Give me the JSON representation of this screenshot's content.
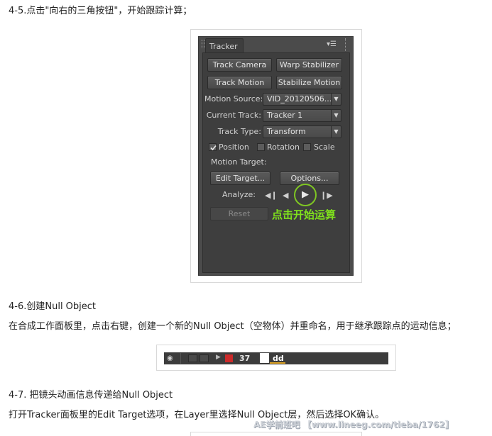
{
  "doc": {
    "step_45": "4-5.点击\"向右的三角按钮\"，开始跟踪计算；",
    "step_46": "4-6.创建Null Object",
    "step_46_desc": "在合成工作面板里，点击右键，创建一个新的Null Object（空物体）并重命名，用于继承跟踪点的运动信息；",
    "step_47": "4-7. 把镜头动画信息传递给Null Object",
    "step_47_desc": "打开Tracker面板里的Edit Target选项，在Layer里选择Null Object层，然后选择OK确认。"
  },
  "tracker": {
    "tab_title": "Tracker",
    "buttons": {
      "track_camera": "Track Camera",
      "warp_stabilizer": "Warp Stabilizer",
      "track_motion": "Track Motion",
      "stabilize_motion": "Stabilize Motion",
      "edit_target": "Edit Target...",
      "options": "Options...",
      "reset": "Reset"
    },
    "labels": {
      "motion_source": "Motion Source:",
      "current_track": "Current Track:",
      "track_type": "Track Type:",
      "motion_target": "Motion Target:",
      "analyze": "Analyze:"
    },
    "values": {
      "motion_source": "VID_20120506...",
      "current_track": "Tracker 1",
      "track_type": "Transform"
    },
    "checkboxes": {
      "position": {
        "label": "Position",
        "checked": true
      },
      "rotation": {
        "label": "Rotation",
        "checked": false
      },
      "scale": {
        "label": "Scale",
        "checked": false
      }
    },
    "annotation": "点击开始运算",
    "colors": {
      "highlight_ring": "#7fc623",
      "annotation_text": "#7fe01d"
    }
  },
  "timeline": {
    "layer_number": "37",
    "layer_name": "dd",
    "label_color": "#cc2a2a"
  },
  "watermark": "AE学前班吧 【www.lineeg.com/tieba/1762】"
}
